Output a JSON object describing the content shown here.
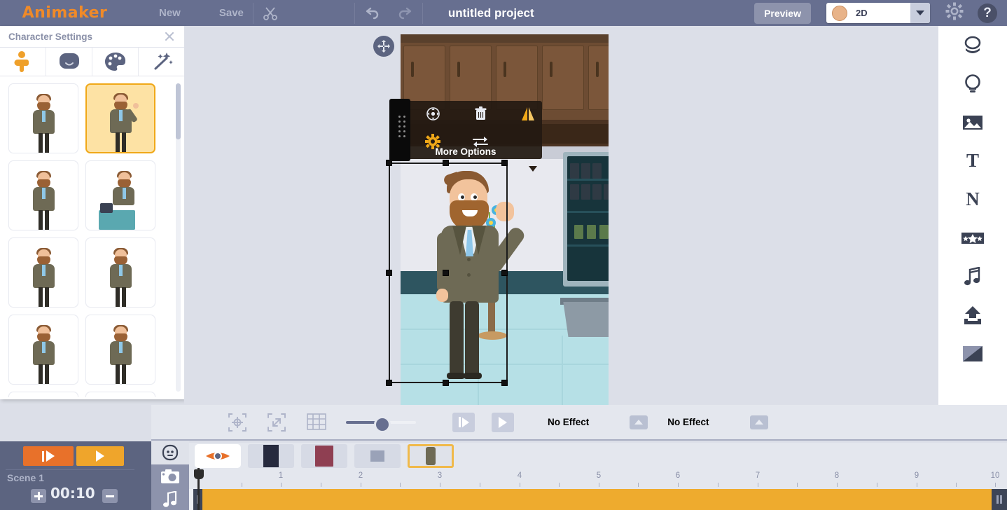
{
  "topbar": {
    "logo": "Animaker",
    "new_label": "New",
    "save_label": "Save",
    "cut_icon": "scissors-icon",
    "copy_icon": "copy-icon",
    "paste_icon": "paste-icon",
    "undo_icon": "undo-icon",
    "redo_icon": "redo-icon",
    "project_title": "untitled project",
    "preview_label": "Preview",
    "mode_value": "2D",
    "settings_icon": "gear-icon",
    "help_label": "?"
  },
  "left_panel": {
    "title": "Character Settings",
    "close_icon": "close-icon",
    "tabs": [
      {
        "name": "body",
        "icon": "body-icon",
        "active": true
      },
      {
        "name": "head",
        "icon": "head-icon",
        "active": false
      },
      {
        "name": "color",
        "icon": "palette-icon",
        "active": false
      },
      {
        "name": "effects",
        "icon": "magic-wand-icon",
        "active": false
      }
    ],
    "thumbnails": [
      {
        "id": 1,
        "pose": "standing",
        "selected": false
      },
      {
        "id": 2,
        "pose": "waving",
        "selected": true
      },
      {
        "id": 3,
        "pose": "walking",
        "selected": false
      },
      {
        "id": 4,
        "pose": "at-desk",
        "selected": false
      },
      {
        "id": 5,
        "pose": "standing",
        "selected": false
      },
      {
        "id": 6,
        "pose": "standing",
        "selected": false
      },
      {
        "id": 7,
        "pose": "standing",
        "selected": false
      },
      {
        "id": 8,
        "pose": "standing",
        "selected": false
      },
      {
        "id": 9,
        "pose": "standing",
        "selected": false
      },
      {
        "id": 10,
        "pose": "standing",
        "selected": false
      }
    ]
  },
  "canvas": {
    "pan_icon": "move-icon",
    "context_menu": {
      "more_options_label": "More Options",
      "items": [
        {
          "name": "move",
          "icon": "move-icon"
        },
        {
          "name": "delete",
          "icon": "trash-icon"
        },
        {
          "name": "flip",
          "icon": "flip-icon"
        },
        {
          "name": "settings",
          "icon": "gear-icon"
        },
        {
          "name": "swap",
          "icon": "swap-icon"
        }
      ]
    }
  },
  "right_rail": {
    "items": [
      {
        "name": "characters",
        "icon": "character-icon"
      },
      {
        "name": "props",
        "icon": "bulb-icon"
      },
      {
        "name": "images",
        "icon": "image-icon"
      },
      {
        "name": "text",
        "icon": "text-icon",
        "letter": "T"
      },
      {
        "name": "numbers",
        "icon": "number-icon",
        "letter": "N"
      },
      {
        "name": "effects",
        "icon": "star-banner-icon"
      },
      {
        "name": "music",
        "icon": "music-note-icon"
      },
      {
        "name": "upload",
        "icon": "upload-icon"
      },
      {
        "name": "background",
        "icon": "gradient-icon"
      }
    ]
  },
  "bottom_toolbar": {
    "align_icon": "align-center-icon",
    "fit_icon": "fit-screen-icon",
    "grid_icon": "grid-icon",
    "zoom_value": 47,
    "step_icon": "step-frame-icon",
    "play_icon": "play-icon",
    "entry_effect": "No Effect",
    "exit_effect": "No Effect",
    "entry_expand_icon": "chevron-up-icon",
    "exit_expand_icon": "chevron-up-icon"
  },
  "playback": {
    "play_scene_icon": "play-scene-icon",
    "play_all_icon": "play-all-icon",
    "scene_label": "Scene 1",
    "duration": "00:10",
    "plus_label": "+",
    "minus_label": "-"
  },
  "timeline": {
    "side_icons": [
      {
        "name": "character-track",
        "icon": "character-icon"
      },
      {
        "name": "camera-track",
        "icon": "camera-icon"
      },
      {
        "name": "music-track",
        "icon": "music-note-icon"
      }
    ],
    "layers": [
      {
        "name": "visibility",
        "icon": "eye-icon",
        "selected": false,
        "style": "white"
      },
      {
        "name": "background-layer",
        "icon": "night-texture",
        "selected": false
      },
      {
        "name": "prop-layer",
        "icon": "maroon-object",
        "selected": false
      },
      {
        "name": "group-layer",
        "icon": "small-figures",
        "selected": false
      },
      {
        "name": "character-layer",
        "icon": "character-thumb",
        "selected": true
      }
    ],
    "ruler_marks": [
      "1",
      "2",
      "3",
      "4",
      "5",
      "6",
      "7",
      "8",
      "9",
      "10"
    ],
    "playhead_position": "0"
  },
  "colors": {
    "topbar_bg": "#676f90",
    "accent_orange": "#e8712a",
    "accent_amber": "#efa52b",
    "selection_border": "#f0a818",
    "canvas_bg": "#dcdfe8",
    "panel_bg": "#ffffff",
    "track_orange": "#eeab2e"
  }
}
